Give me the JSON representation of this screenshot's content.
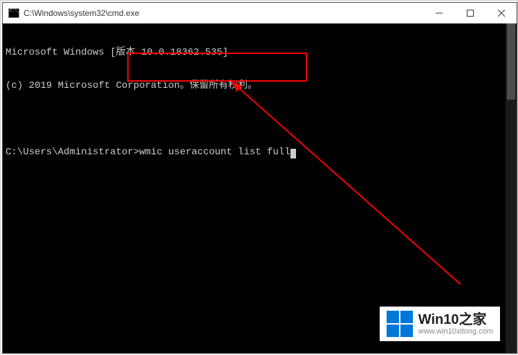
{
  "window": {
    "title": "C:\\Windows\\system32\\cmd.exe"
  },
  "terminal": {
    "line1": "Microsoft Windows [版本 10.0.18362.535]",
    "line2": "(c) 2019 Microsoft Corporation。保留所有权利。",
    "prompt": "C:\\Users\\Administrator>",
    "command": "wmic useraccount list full"
  },
  "watermark": {
    "title": "Win10之家",
    "url": "www.win10xitong.com"
  },
  "annotation": {
    "highlight_color": "#ff0000"
  }
}
